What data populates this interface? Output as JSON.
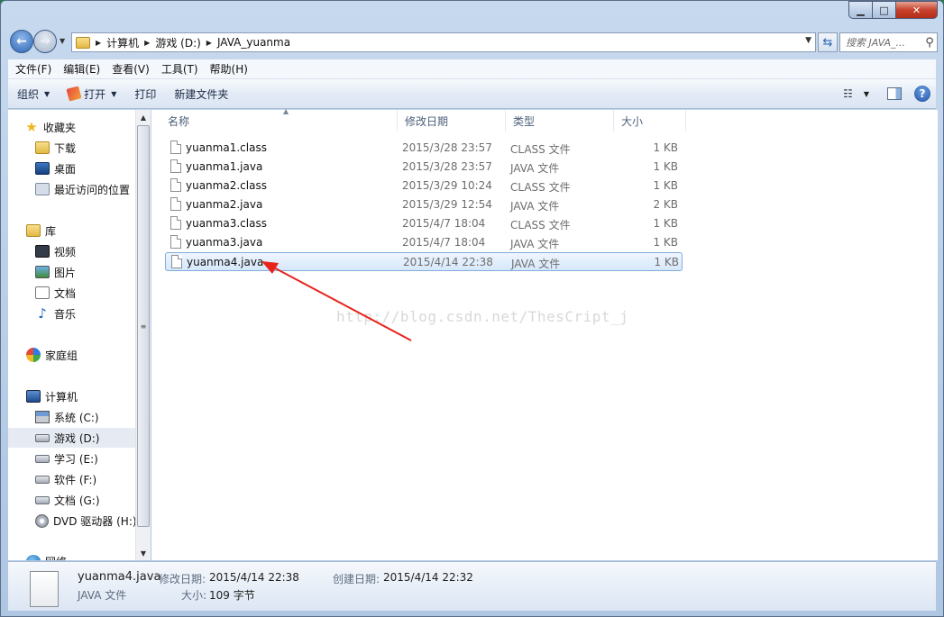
{
  "breadcrumb": [
    "计算机",
    "游戏 (D:)",
    "JAVA_yuanma"
  ],
  "search_placeholder": "搜索 JAVA_...",
  "menu": [
    "文件(F)",
    "编辑(E)",
    "查看(V)",
    "工具(T)",
    "帮助(H)"
  ],
  "toolbar": {
    "organize": "组织",
    "open": "打开",
    "print": "打印",
    "new_folder": "新建文件夹"
  },
  "nav": {
    "favorites": "收藏夹",
    "downloads": "下载",
    "desktop": "桌面",
    "recent": "最近访问的位置",
    "libraries": "库",
    "videos": "视频",
    "pictures": "图片",
    "documents": "文档",
    "music": "音乐",
    "homegroup": "家庭组",
    "computer": "计算机",
    "drive_c": "系统 (C:)",
    "drive_d": "游戏 (D:)",
    "drive_e": "学习 (E:)",
    "drive_f": "软件 (F:)",
    "drive_g": "文档 (G:)",
    "drive_h": "DVD 驱动器 (H:)",
    "network": "网络"
  },
  "columns": {
    "name": "名称",
    "date": "修改日期",
    "type": "类型",
    "size": "大小"
  },
  "files": [
    {
      "name": "yuanma1.class",
      "date": "2015/3/28 23:57",
      "type": "CLASS 文件",
      "size": "1 KB"
    },
    {
      "name": "yuanma1.java",
      "date": "2015/3/28 23:57",
      "type": "JAVA 文件",
      "size": "1 KB"
    },
    {
      "name": "yuanma2.class",
      "date": "2015/3/29 10:24",
      "type": "CLASS 文件",
      "size": "1 KB"
    },
    {
      "name": "yuanma2.java",
      "date": "2015/3/29 12:54",
      "type": "JAVA 文件",
      "size": "2 KB"
    },
    {
      "name": "yuanma3.class",
      "date": "2015/4/7 18:04",
      "type": "CLASS 文件",
      "size": "1 KB"
    },
    {
      "name": "yuanma3.java",
      "date": "2015/4/7 18:04",
      "type": "JAVA 文件",
      "size": "1 KB"
    },
    {
      "name": "yuanma4.java",
      "date": "2015/4/14 22:38",
      "type": "JAVA 文件",
      "size": "1 KB"
    }
  ],
  "watermark": "http://blog.csdn.net/ThesCript_j",
  "details": {
    "name": "yuanma4.java",
    "type": "JAVA 文件",
    "modified_label": "修改日期:",
    "modified": "2015/4/14 22:38",
    "created_label": "创建日期:",
    "created": "2015/4/14 22:32",
    "size_label": "大小:",
    "size": "109 字节"
  },
  "colors": {
    "selection_border": "#84acdd",
    "arrow": "#e8231b",
    "close_button": "#c7422c"
  }
}
